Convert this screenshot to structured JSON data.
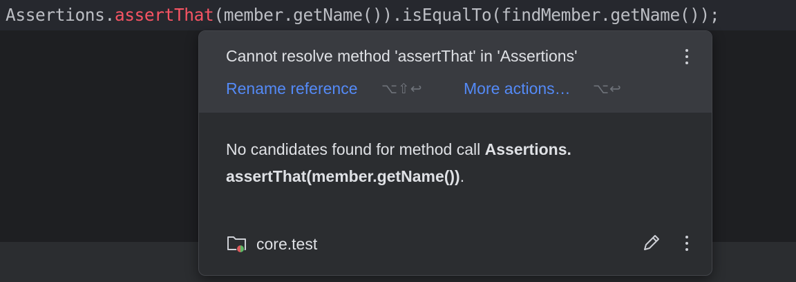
{
  "editor": {
    "code_prefix": "Assertions.",
    "code_error": "assertThat",
    "code_suffix": "(member.getName()).isEqualTo(findMember.getName());"
  },
  "popup": {
    "title": "Cannot resolve method 'assertThat' in 'Assertions'",
    "actions": [
      {
        "label": "Rename reference",
        "shortcut": "⌥⇧↩"
      },
      {
        "label": "More actions…",
        "shortcut": "⌥↩"
      }
    ],
    "message": {
      "text": "No candidates found for method call ",
      "bold_1": "Assertions.",
      "bold_2": "assertThat(member.getName())",
      "end": "."
    },
    "footer": {
      "module": "core.test"
    }
  },
  "colors": {
    "error_text": "#f75464",
    "link": "#548af7",
    "background": "#1e1f22",
    "popup_bg": "#2b2d30",
    "popup_header_bg": "#393b40"
  },
  "icons": [
    "more-vertical-icon",
    "test-folder-icon",
    "edit-pencil-icon"
  ]
}
